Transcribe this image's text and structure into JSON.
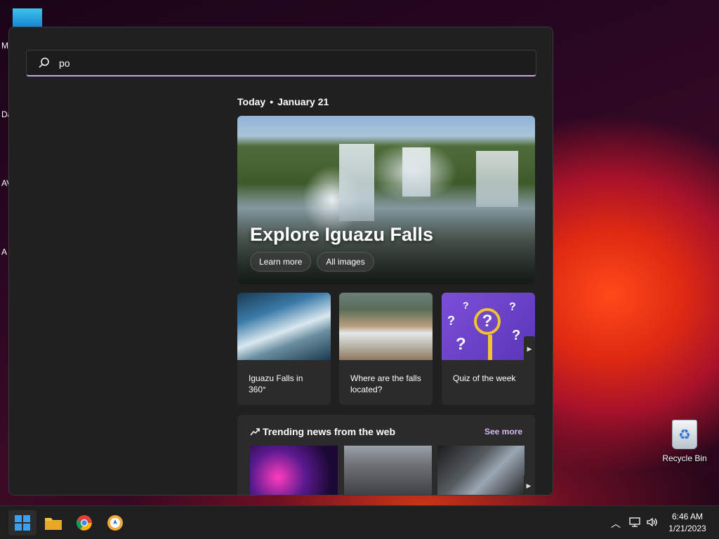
{
  "desktop": {
    "left_labels": [
      "M",
      "Da",
      "AV",
      "A"
    ],
    "recycle_bin": {
      "label": "Recycle Bin"
    }
  },
  "search": {
    "query": "po"
  },
  "today": {
    "label": "Today",
    "separator": "•",
    "date": "January 21"
  },
  "hero": {
    "title": "Explore Iguazu Falls",
    "learn_more": "Learn more",
    "all_images": "All images"
  },
  "cards": [
    {
      "label": "Iguazu Falls in 360°"
    },
    {
      "label": "Where are the falls located?"
    },
    {
      "label": "Quiz of the week"
    }
  ],
  "trending": {
    "title": "Trending news from the web",
    "see_more": "See more"
  },
  "taskbar": {
    "apps": [
      "start",
      "file-explorer",
      "chrome",
      "browser"
    ],
    "time": "6:46 AM",
    "date": "1/21/2023"
  },
  "colors": {
    "accent": "#c9a6e8",
    "panel": "#202020",
    "card": "#2b2b2b",
    "taskbar": "#1f1f1f"
  }
}
